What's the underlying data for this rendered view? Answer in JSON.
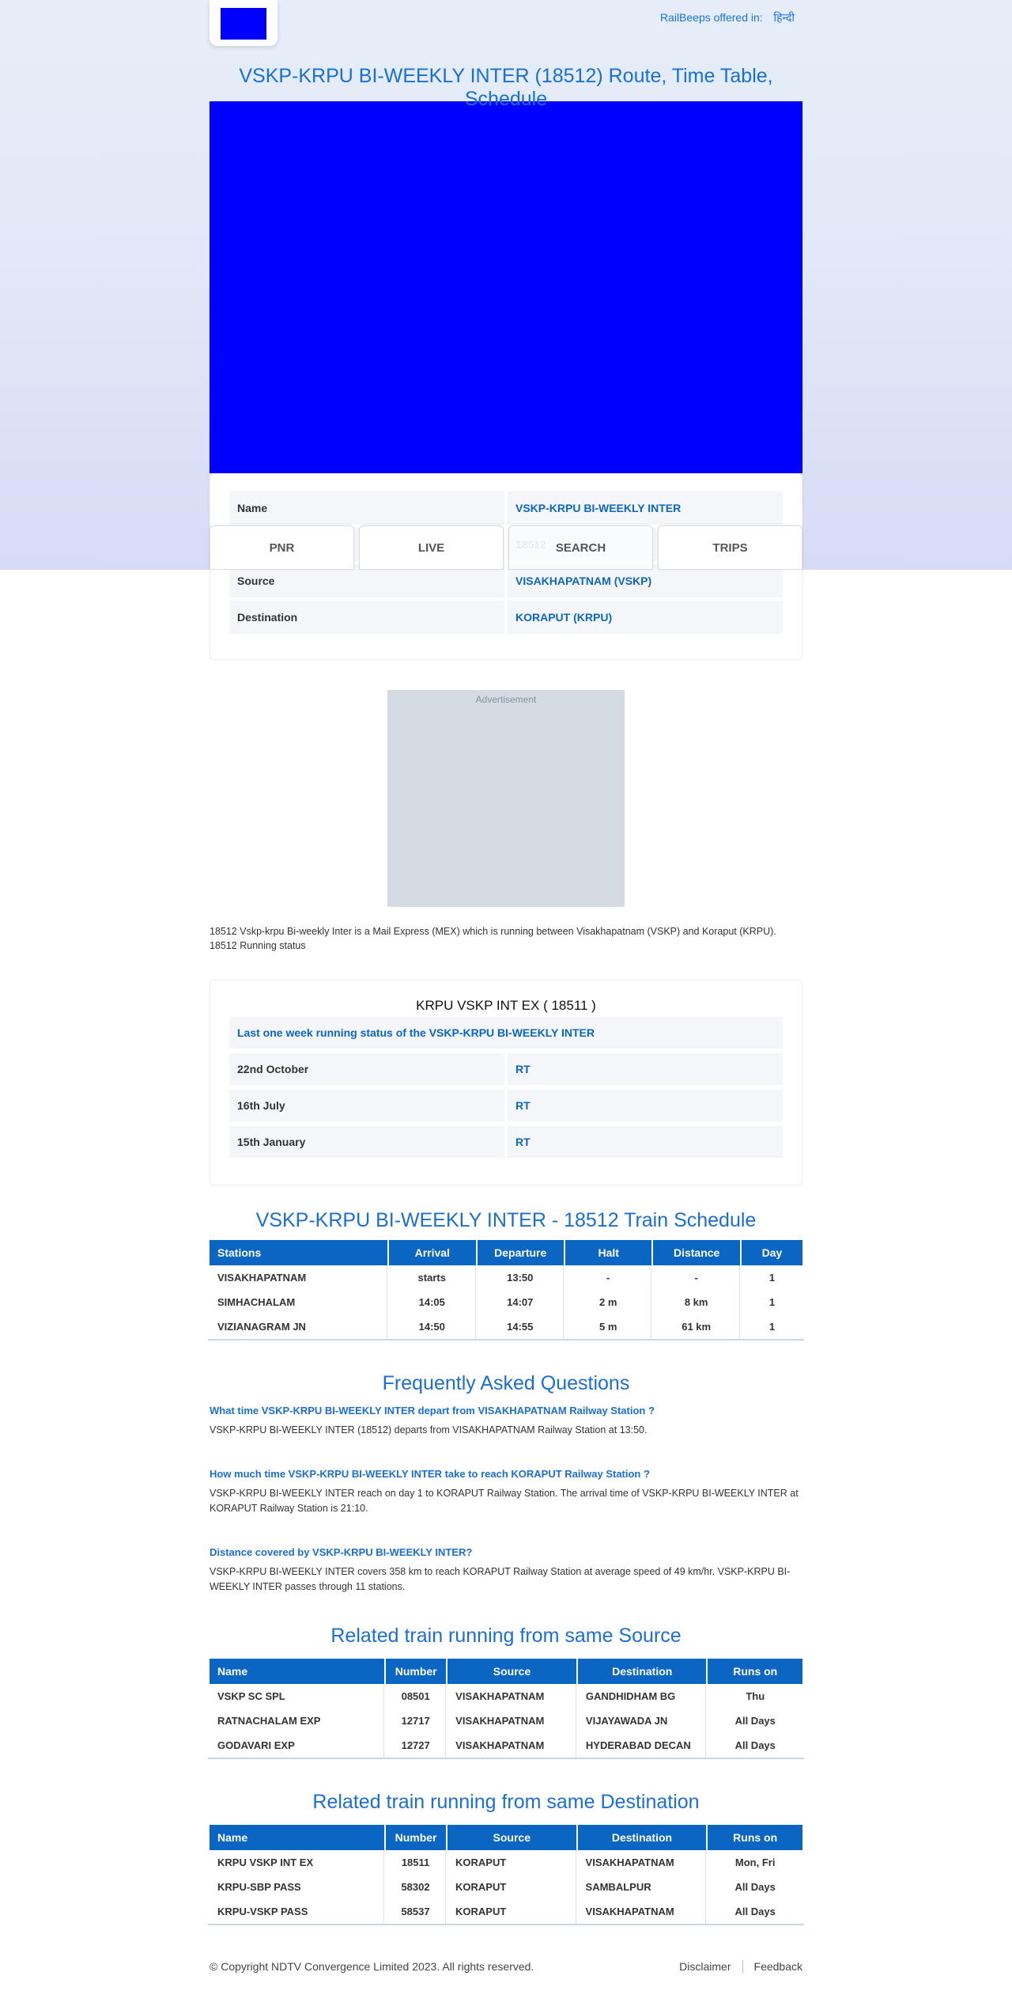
{
  "header": {
    "offered_label": "RailBeeps offered in:",
    "language": "हिन्दी"
  },
  "page_title": "VSKP-KRPU BI-WEEKLY INTER (18512) Route, Time Table, Schedule",
  "info": {
    "rows": [
      {
        "key": "Name",
        "value": "VSKP-KRPU BI-WEEKLY INTER"
      },
      {
        "key": "Number",
        "value": "18512"
      },
      {
        "key": "Source",
        "value": "VISAKHAPATNAM (VSKP)"
      },
      {
        "key": "Destination",
        "value": "KORAPUT (KRPU)"
      }
    ]
  },
  "nav_tabs": [
    "PNR",
    "LIVE",
    "SEARCH",
    "TRIPS"
  ],
  "ad_label": "Advertisement",
  "description": "18512 Vskp-krpu Bi-weekly Inter is a Mail Express (MEX) which is running between Visakhapatnam (VSKP) and Koraput (KRPU). 18512 Running status",
  "running_status": {
    "title": "KRPU VSKP INT EX ( 18511 )",
    "subtitle": "Last one week running status of the VSKP-KRPU BI-WEEKLY INTER",
    "rows": [
      {
        "date": "22nd October",
        "status": "RT"
      },
      {
        "date": "16th July",
        "status": "RT"
      },
      {
        "date": "15th January",
        "status": "RT"
      }
    ]
  },
  "schedule": {
    "title": "VSKP-KRPU BI-WEEKLY INTER - 18512 Train Schedule",
    "columns": [
      "Stations",
      "Arrival",
      "Departure",
      "Halt",
      "Distance",
      "Day"
    ],
    "rows": [
      [
        "VISAKHAPATNAM",
        "starts",
        "13:50",
        "-",
        "-",
        "1"
      ],
      [
        "SIMHACHALAM",
        "14:05",
        "14:07",
        "2 m",
        "8 km",
        "1"
      ],
      [
        "VIZIANAGRAM JN",
        "14:50",
        "14:55",
        "5 m",
        "61 km",
        "1"
      ]
    ]
  },
  "faq": {
    "title": "Frequently Asked Questions",
    "items": [
      {
        "q": "What time VSKP-KRPU BI-WEEKLY INTER depart from VISAKHAPATNAM Railway Station ?",
        "a": "VSKP-KRPU BI-WEEKLY INTER (18512) departs from VISAKHAPATNAM Railway Station at 13:50."
      },
      {
        "q": "How much time VSKP-KRPU BI-WEEKLY INTER take to reach KORAPUT Railway Station ?",
        "a": "VSKP-KRPU BI-WEEKLY INTER reach on day 1 to KORAPUT Railway Station. The arrival time of VSKP-KRPU BI-WEEKLY INTER at KORAPUT Railway Station is 21:10."
      },
      {
        "q": "Distance covered by VSKP-KRPU BI-WEEKLY INTER?",
        "a": "VSKP-KRPU BI-WEEKLY INTER covers 358 km to reach KORAPUT Railway Station at average speed of 49 km/hr. VSKP-KRPU BI-WEEKLY INTER passes through 11 stations."
      }
    ]
  },
  "related_source": {
    "title": "Related train running from same Source",
    "columns": [
      "Name",
      "Number",
      "Source",
      "Destination",
      "Runs on"
    ],
    "rows": [
      [
        "VSKP SC SPL",
        "08501",
        "VISAKHAPATNAM",
        "GANDHIDHAM BG",
        "Thu"
      ],
      [
        "RATNACHALAM EXP",
        "12717",
        "VISAKHAPATNAM",
        "VIJAYAWADA JN",
        "All Days"
      ],
      [
        "GODAVARI EXP",
        "12727",
        "VISAKHAPATNAM",
        "HYDERABAD DECAN",
        "All Days"
      ]
    ]
  },
  "related_destination": {
    "title": "Related train running from same Destination",
    "columns": [
      "Name",
      "Number",
      "Source",
      "Destination",
      "Runs on"
    ],
    "rows": [
      [
        "KRPU VSKP INT EX",
        "18511",
        "KORAPUT",
        "VISAKHAPATNAM",
        "Mon, Fri"
      ],
      [
        "KRPU-SBP PASS",
        "58302",
        "KORAPUT",
        "SAMBALPUR",
        "All Days"
      ],
      [
        "KRPU-VSKP PASS",
        "58537",
        "KORAPUT",
        "VISAKHAPATNAM",
        "All Days"
      ]
    ]
  },
  "footer": {
    "copyright": "© Copyright NDTV Convergence Limited 2023. All rights reserved.",
    "disclaimer": "Disclaimer",
    "feedback": "Feedback"
  },
  "colors": {
    "accent": "#1a6fd6",
    "table_header": "#0b66c3",
    "logo": "#0000ff"
  }
}
